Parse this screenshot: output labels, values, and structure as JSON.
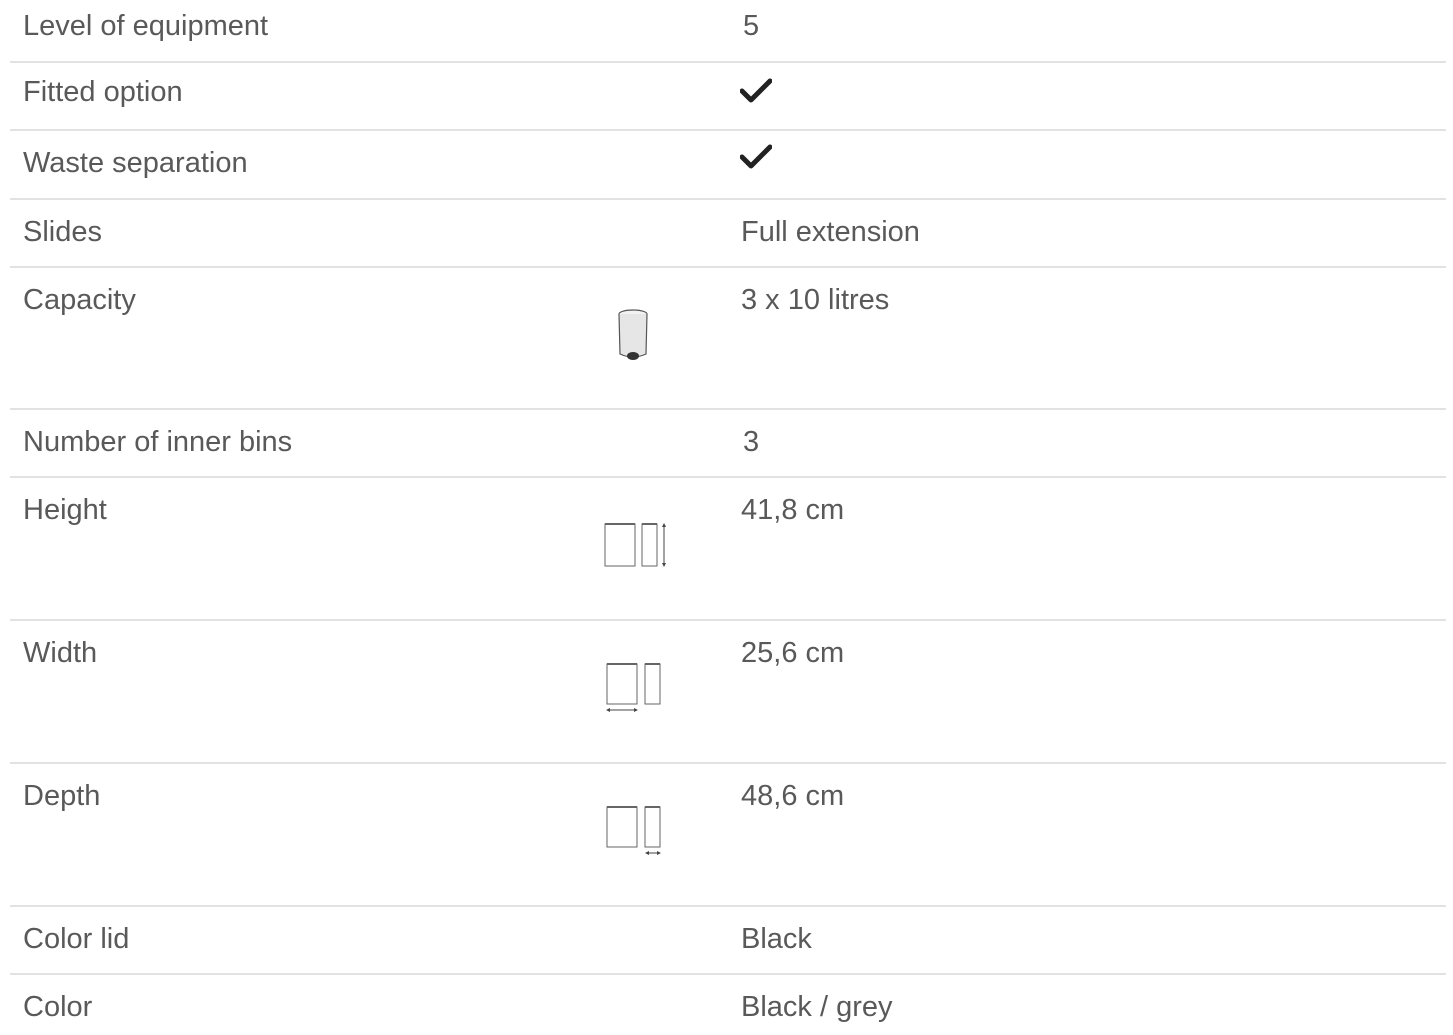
{
  "rows": [
    {
      "label": "Level of equipment",
      "value": "5"
    },
    {
      "label": "Fitted option",
      "value_icon": "checkmark-icon"
    },
    {
      "label": "Waste separation",
      "value_icon": "checkmark-icon"
    },
    {
      "label": "Slides",
      "value": "Full extension"
    },
    {
      "label": "Capacity",
      "value": "3 x 10 litres",
      "icon": "bin-icon"
    },
    {
      "label": "Number of inner bins",
      "value": "3"
    },
    {
      "label": "Height",
      "value": "41,8 cm",
      "icon": "height-dimension-icon"
    },
    {
      "label": "Width",
      "value": "25,6 cm",
      "icon": "width-dimension-icon"
    },
    {
      "label": "Depth",
      "value": "48,6 cm",
      "icon": "depth-dimension-icon"
    },
    {
      "label": "Color lid",
      "value": "Black"
    },
    {
      "label": "Color",
      "value": "Black / grey"
    }
  ],
  "colors": {
    "text": "#595959",
    "divider": "#e2e2e2",
    "check": "#222222"
  }
}
